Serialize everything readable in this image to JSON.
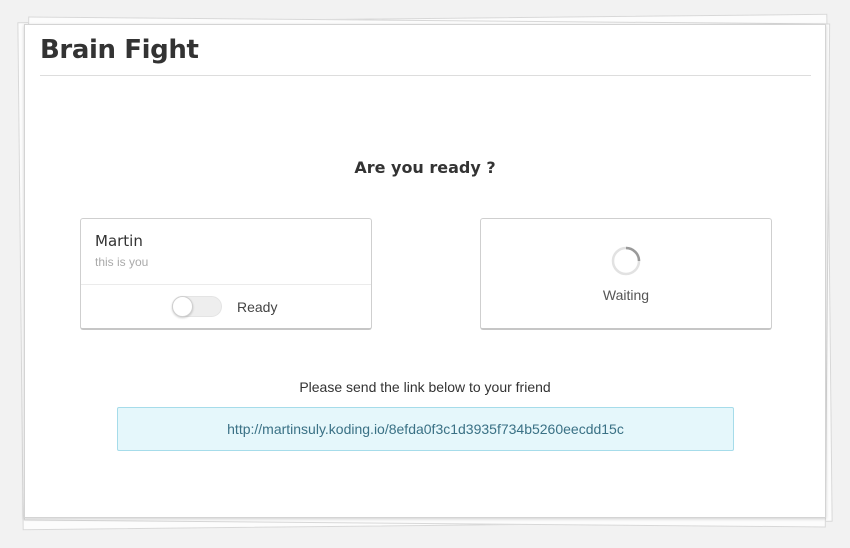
{
  "app": {
    "title": "Brain Fight"
  },
  "lobby": {
    "question": "Are you ready ?",
    "me": {
      "name": "Martin",
      "subtitle": "this is you",
      "ready_toggle": {
        "label": "Ready",
        "on": false
      }
    },
    "opponent": {
      "status": "Waiting",
      "status_icon": "spinner-icon"
    },
    "share": {
      "instruction": "Please send the link below to your friend",
      "link": "http://martinsuly.koding.io/8efda0f3c1d3935f734b5260eecdd15c"
    }
  },
  "colors": {
    "title_text": "#333333",
    "link_box_bg": "#e5f7fb",
    "link_box_border": "#a6dcea",
    "link_text": "#3a7185",
    "muted_text": "#aaaaaa"
  }
}
